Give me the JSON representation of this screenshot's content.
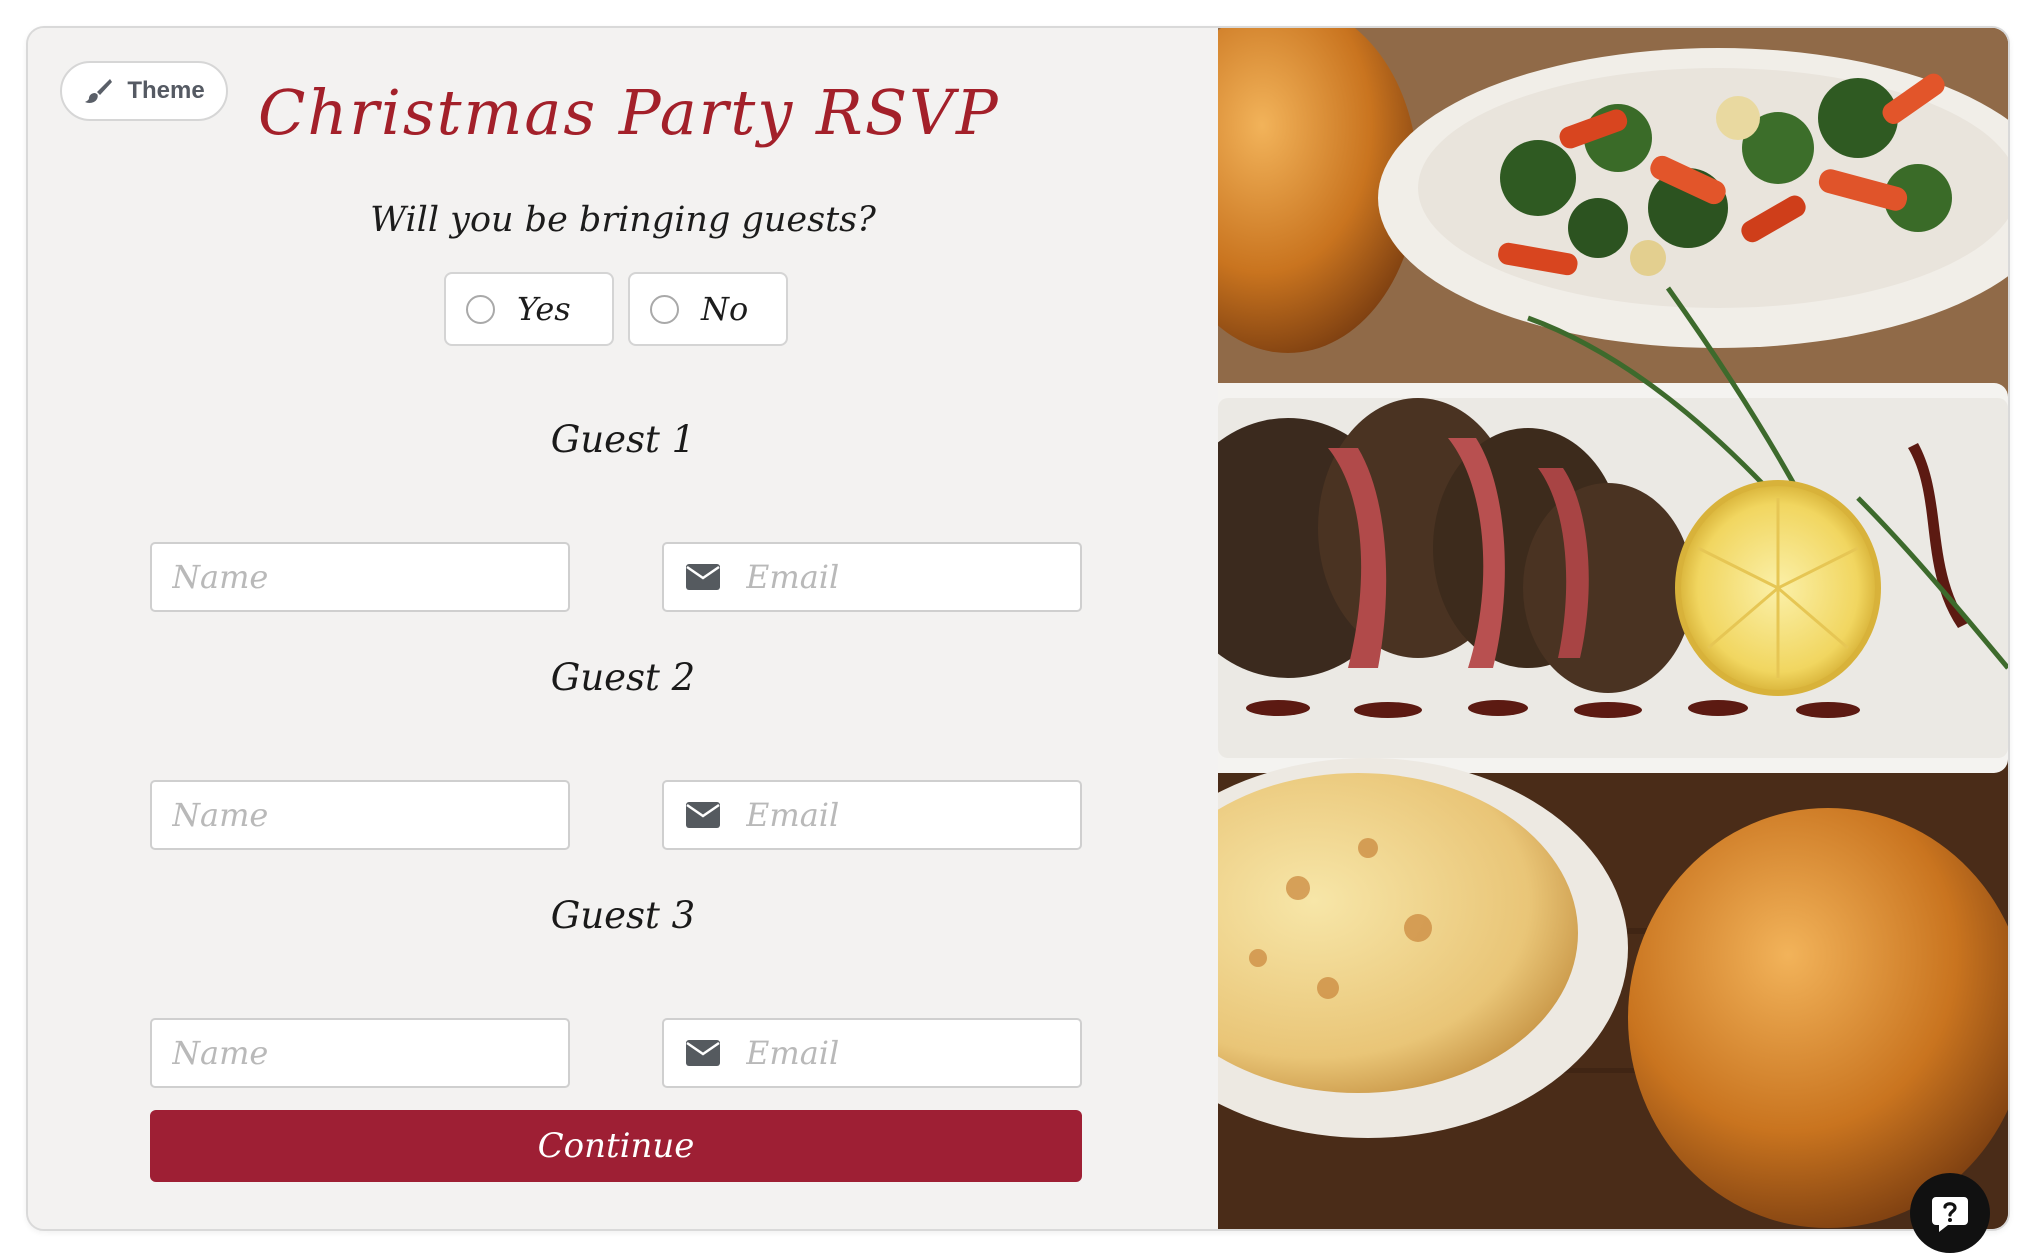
{
  "theme_button": {
    "label": "Theme",
    "icon": "paintbrush-icon"
  },
  "form": {
    "title": "Christmas Party RSVP",
    "question": "Will you be bringing guests?",
    "options": [
      {
        "label": "Yes",
        "selected": false
      },
      {
        "label": "No",
        "selected": false
      }
    ],
    "guests": [
      {
        "heading": "Guest 1",
        "name_placeholder": "Name",
        "email_placeholder": "Email"
      },
      {
        "heading": "Guest 2",
        "name_placeholder": "Name",
        "email_placeholder": "Email"
      },
      {
        "heading": "Guest 3",
        "name_placeholder": "Name",
        "email_placeholder": "Email"
      }
    ],
    "continue_label": "Continue"
  },
  "image_panel": {
    "subject": "holiday dinner spread"
  },
  "help_button": {
    "icon": "help-question-icon"
  },
  "colors": {
    "accent": "#a3202a",
    "button": "#9e1f34",
    "form_background": "#f3f2f1"
  }
}
